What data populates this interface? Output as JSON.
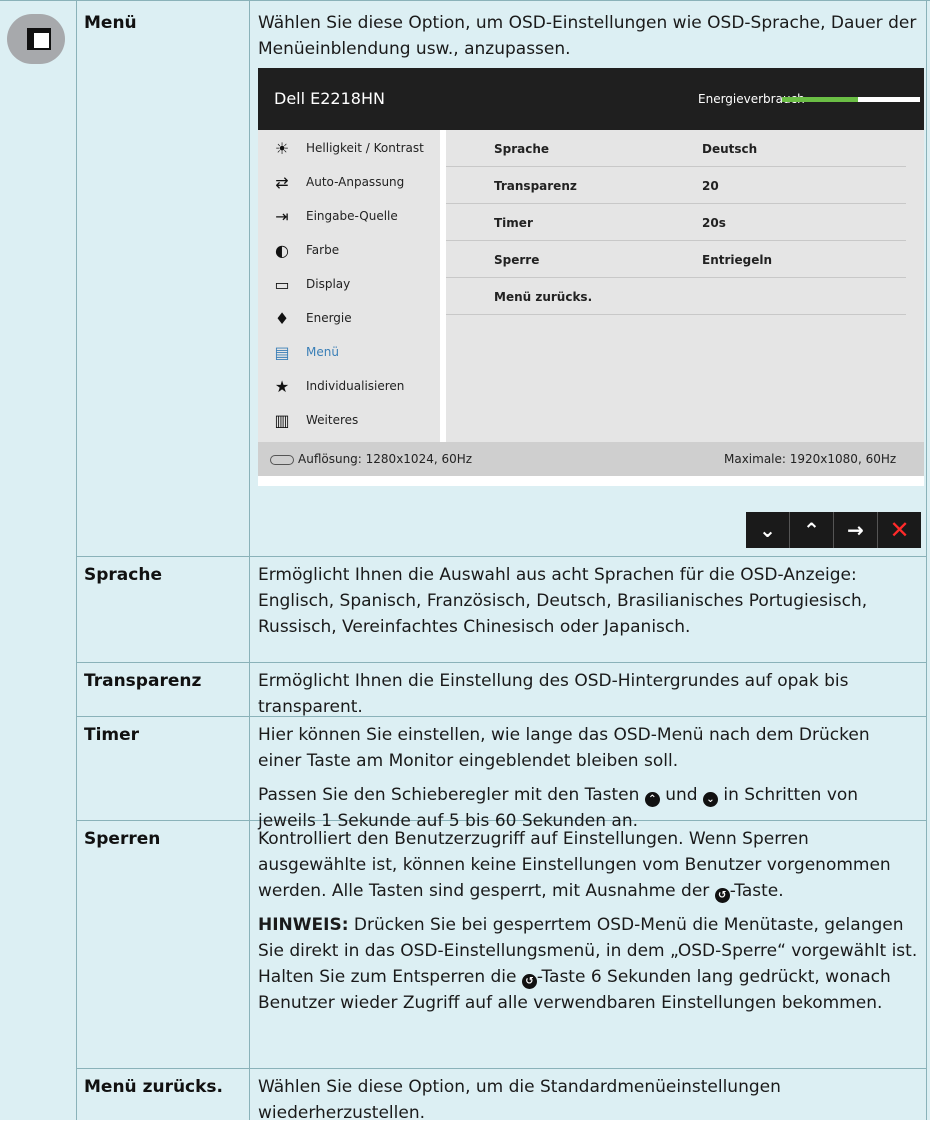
{
  "menu_row": {
    "label": "Menü",
    "description": "Wählen Sie diese Option, um OSD-Einstellungen wie OSD-Sprache, Dauer der Menüeinblendung usw., anzupassen."
  },
  "osd": {
    "title": "Dell E2218HN",
    "energy_label": "Energieverbrauch",
    "energy_level": 0.55,
    "sidebar": [
      {
        "label": "Helligkeit / Kontrast",
        "icon": "sun-icon"
      },
      {
        "label": "Auto-Anpassung",
        "icon": "refresh-icon"
      },
      {
        "label": "Eingabe-Quelle",
        "icon": "input-icon"
      },
      {
        "label": "Farbe",
        "icon": "color-icon"
      },
      {
        "label": "Display",
        "icon": "monitor-icon"
      },
      {
        "label": "Energie",
        "icon": "power-icon"
      },
      {
        "label": "Menü",
        "icon": "menu-icon",
        "active": true
      },
      {
        "label": "Individualisieren",
        "icon": "star-icon"
      },
      {
        "label": "Weiteres",
        "icon": "sliders-icon"
      }
    ],
    "settings": [
      {
        "key": "Sprache",
        "value": "Deutsch"
      },
      {
        "key": "Transparenz",
        "value": "20"
      },
      {
        "key": "Timer",
        "value": "20s"
      },
      {
        "key": "Sperre",
        "value": "Entriegeln"
      },
      {
        "key": "Menü zurücks.",
        "value": ""
      }
    ],
    "resolution": "Auflösung: 1280x1024, 60Hz",
    "max_resolution": "Maximale: 1920x1080, 60Hz",
    "buttons": [
      {
        "name": "down-button",
        "glyph": "⌄"
      },
      {
        "name": "up-button",
        "glyph": "⌃"
      },
      {
        "name": "right-button",
        "glyph": "→"
      },
      {
        "name": "close-button",
        "glyph": "✕"
      }
    ]
  },
  "rows": {
    "sprache": {
      "label": "Sprache",
      "text": "Ermöglicht Ihnen die Auswahl aus acht Sprachen für die OSD-Anzeige: Englisch, Spanisch, Französisch, Deutsch, Brasilianisches Portugiesisch, Russisch, Vereinfachtes Chinesisch oder Japanisch."
    },
    "transparenz": {
      "label": "Transparenz",
      "text": "Ermöglicht Ihnen die Einstellung des OSD-Hintergrundes auf opak bis transparent."
    },
    "timer": {
      "label": "Timer",
      "text1": "Hier können Sie einstellen, wie lange das OSD-Menü nach dem Drücken einer Taste am Monitor eingeblendet bleiben soll.",
      "text2_a": "Passen Sie den Schieberegler mit den Tasten",
      "text2_b": "und",
      "text2_c": "in Schritten von jeweils 1 Sekunde auf 5 bis 60 Sekunden an."
    },
    "sperren": {
      "label": "Sperren",
      "text1_a": "Kontrolliert den Benutzerzugriff auf Einstellungen. Wenn Sperren ausgewählte ist, können keine Einstellungen vom Benutzer vorgenommen werden. Alle Tasten sind gesperrt, mit Ausnahme der",
      "text1_b": "-Taste.",
      "note_label": "HINWEIS:",
      "note_a": "Drücken Sie bei gesperrtem OSD-Menü die Menütaste, gelangen Sie direkt in das OSD-Einstellungsmenü, in dem „OSD-Sperre“ vorgewählt ist. Halten Sie zum Entsperren die",
      "note_b": "-Taste 6 Sekunden lang gedrückt, wonach Benutzer wieder Zugriff auf alle verwendbaren Einstellungen bekommen."
    },
    "reset": {
      "label": "Menü zurücks.",
      "text": "Wählen Sie diese Option, um die Standardmenüeinstellungen wiederherzustellen."
    }
  }
}
